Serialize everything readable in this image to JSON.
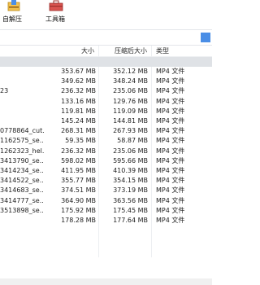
{
  "toolbar": {
    "extract_label": "自解压",
    "toolbox_label": "工具箱"
  },
  "columns": {
    "size": "大小",
    "compressed": "压缩后大小",
    "type": "类型"
  },
  "files": [
    {
      "name": "",
      "size": "353.67 MB",
      "compressed": "352.12 MB",
      "type": "MP4 文件"
    },
    {
      "name": "",
      "size": "349.62 MB",
      "compressed": "348.24 MB",
      "type": "MP4 文件"
    },
    {
      "name": "23",
      "size": "236.32 MB",
      "compressed": "235.06 MB",
      "type": "MP4 文件"
    },
    {
      "name": "",
      "size": "133.16 MB",
      "compressed": "129.76 MB",
      "type": "MP4 文件"
    },
    {
      "name": "",
      "size": "119.81 MB",
      "compressed": "119.09 MB",
      "type": "MP4 文件"
    },
    {
      "name": "",
      "size": "145.24 MB",
      "compressed": "144.81 MB",
      "type": "MP4 文件"
    },
    {
      "name": "0778864_cut...",
      "size": "268.31 MB",
      "compressed": "267.93 MB",
      "type": "MP4 文件"
    },
    {
      "name": "1162575_se...",
      "size": "59.35 MB",
      "compressed": "58.87 MB",
      "type": "MP4 文件"
    },
    {
      "name": "1262323_hel...",
      "size": "236.32 MB",
      "compressed": "235.06 MB",
      "type": "MP4 文件"
    },
    {
      "name": "3413790_se...",
      "size": "598.02 MB",
      "compressed": "595.66 MB",
      "type": "MP4 文件"
    },
    {
      "name": "3414234_se...",
      "size": "411.95 MB",
      "compressed": "410.39 MB",
      "type": "MP4 文件"
    },
    {
      "name": "3414522_se...",
      "size": "355.77 MB",
      "compressed": "354.15 MB",
      "type": "MP4 文件"
    },
    {
      "name": "3414683_se...",
      "size": "374.51 MB",
      "compressed": "373.19 MB",
      "type": "MP4 文件"
    },
    {
      "name": "3414777_se...",
      "size": "364.90 MB",
      "compressed": "363.56 MB",
      "type": "MP4 文件"
    },
    {
      "name": "3513898_se...",
      "size": "175.92 MB",
      "compressed": "175.45 MB",
      "type": "MP4 文件"
    },
    {
      "name": "",
      "size": "178.28 MB",
      "compressed": "177.64 MB",
      "type": "MP4 文件"
    }
  ],
  "icons": {
    "extract": "self-extract-icon",
    "toolbox": "toolbox-icon"
  },
  "colors": {
    "accent": "#4a8ee6",
    "parent_row": "#dfe2e6"
  }
}
